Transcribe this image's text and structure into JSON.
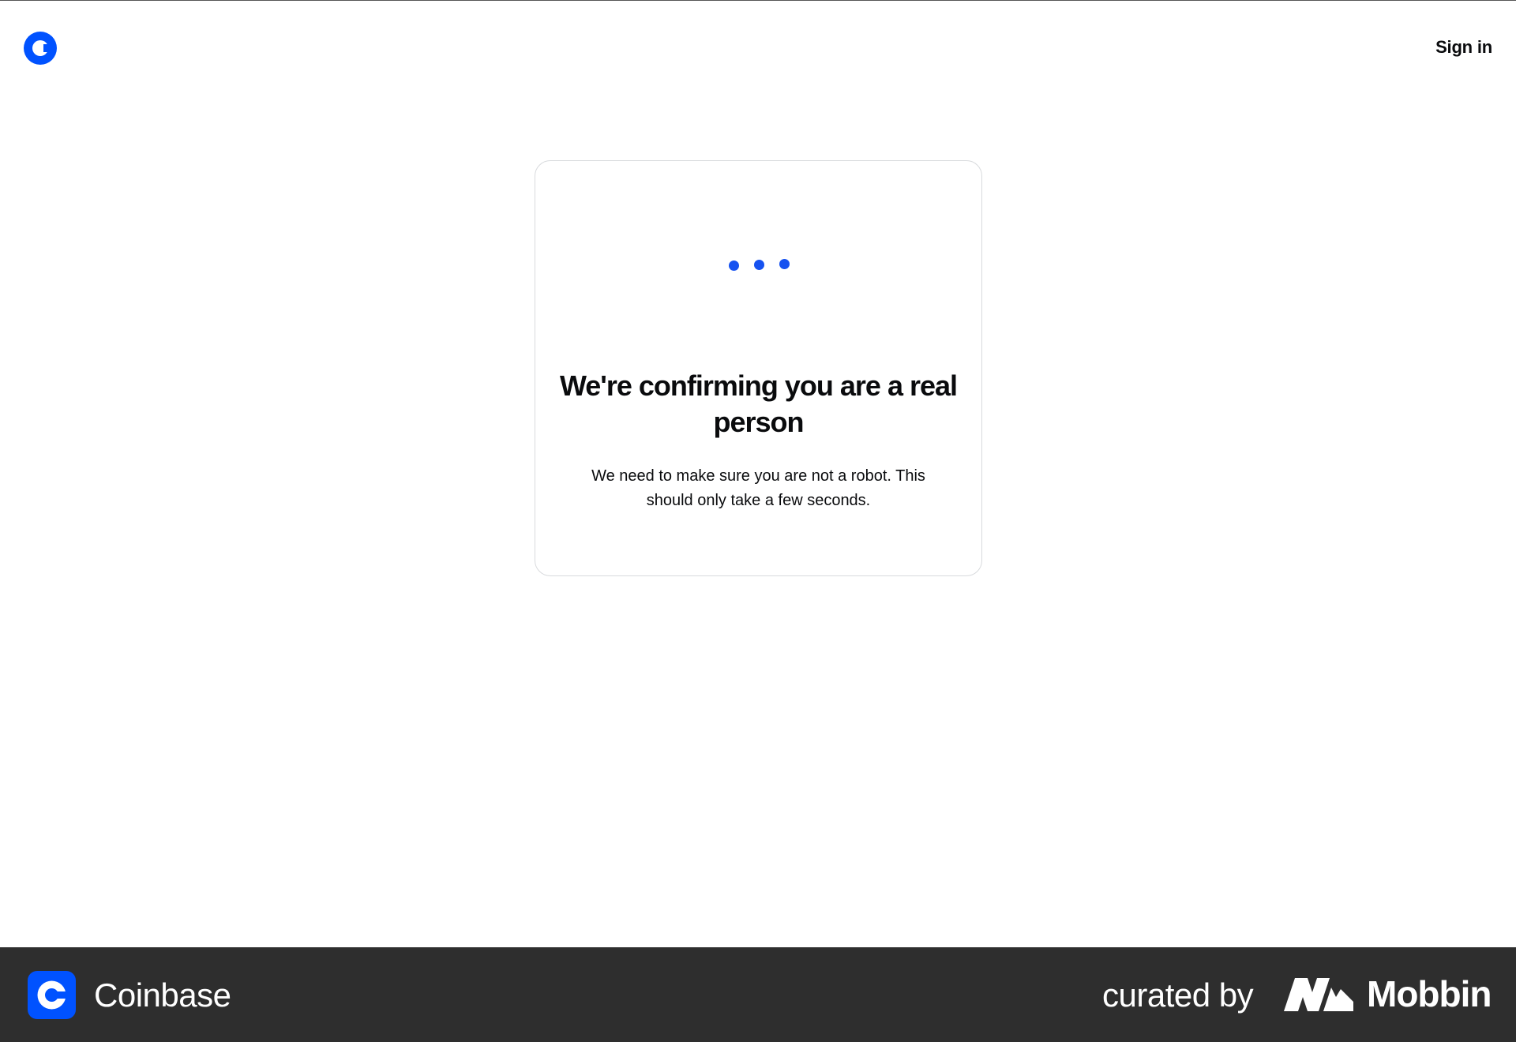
{
  "header": {
    "logo_icon": "coinbase-c-logo-icon",
    "signin_label": "Sign in"
  },
  "card": {
    "loader": {
      "icon": "loading-dots-icon",
      "dots": 3
    },
    "heading": "We're confirming you are a real person",
    "subtext": "We need to make sure you are not a robot. This should only take a few seconds."
  },
  "footer": {
    "brand_icon": "coinbase-app-icon",
    "brand_name": "Coinbase",
    "curated_label": "curated by",
    "curator_icon": "mobbin-logo-icon",
    "curator_name": "Mobbin"
  },
  "colors": {
    "brand_blue": "#0052ff",
    "loader_blue": "#1652f0",
    "text": "#0a0b0d",
    "card_border": "#d8dadd",
    "footer_bg": "#2e2e2e",
    "footer_text": "#ffffff"
  }
}
